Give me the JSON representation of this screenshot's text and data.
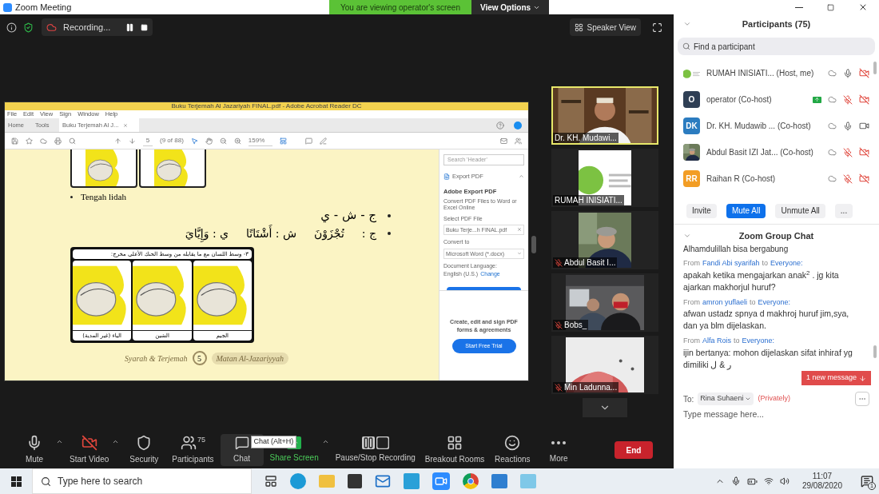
{
  "window": {
    "title": "Zoom Meeting"
  },
  "banner": {
    "text": "You are viewing operator's screen",
    "options": "View Options"
  },
  "top_bar": {
    "recording": "Recording...",
    "view_button": "Speaker View"
  },
  "shared_screen": {
    "app_title": "Buku Terjemah Al Jazariyah FINAL.pdf - Adobe Acrobat Reader DC",
    "menu": [
      "File",
      "Edit",
      "View",
      "Sign",
      "Window",
      "Help"
    ],
    "tabs": [
      {
        "label": "Home",
        "selected": false
      },
      {
        "label": "Tools",
        "selected": false
      },
      {
        "label": "Buku Terjemah Al J...",
        "selected": true
      }
    ],
    "page_field": "5",
    "page_count": "(9 of 88)",
    "zoom": "159%",
    "document": {
      "bullet": "Tengah lidah",
      "arabic_line": "ج - ش - ي",
      "examples": [
        "ج  :",
        "تُجْزَوْنَ",
        "ش : أَشْتَاتًا",
        "ي : وَإِيَّايَ"
      ],
      "figure_caption": "٣- وسط اللسان مع ما يقابله من وسط الحنك الأعلى مخرج:",
      "figure_labels": [
        "الجيم",
        "الشين",
        "الياء (غير المدية)"
      ],
      "footer_left": "Syarah & Terjemah",
      "page_number": "5",
      "footer_right": "Matan Al-Jazariyyah"
    },
    "side_pane": {
      "search_placeholder": "Search 'Header'",
      "section": "Export PDF",
      "heading": "Adobe Export PDF",
      "description": "Convert PDF Files to Word or Excel Online",
      "select_label": "Select PDF File",
      "file": "Buku Terje...h FINAL.pdf",
      "convert_label": "Convert to",
      "convert_value": "Microsoft Word (*.docx)",
      "language_label": "Document Language:",
      "language_value": "English (U.S.)",
      "change_link": "Change",
      "promo": "Create, edit and sign PDF forms & agreements",
      "trial_button": "Start Free Trial"
    }
  },
  "video_tiles": [
    {
      "name": "Dr. KH. Mudawi...",
      "active": true,
      "mic_muted": false
    },
    {
      "name": "RUMAH INISIATI...",
      "active": false,
      "mic_muted": false
    },
    {
      "name": "Abdul Basit I...",
      "active": false,
      "mic_muted": true
    },
    {
      "name": "Bobs_",
      "active": false,
      "mic_muted": true
    },
    {
      "name": "Min Ladunna...",
      "active": false,
      "mic_muted": true
    }
  ],
  "participants": {
    "title": "Participants (75)",
    "search_placeholder": "Find a participant",
    "rows": [
      {
        "kind": "picture",
        "label": "RUMAH INISIATI...  (Host, me)",
        "sharing": false,
        "mic_muted": false,
        "video_off": true
      },
      {
        "kind": "initials",
        "initials": "O",
        "color": "#2f3f55",
        "label": "operator (Co-host)",
        "sharing": true,
        "mic_muted": true,
        "video_off": true
      },
      {
        "kind": "initials",
        "initials": "DK",
        "color": "#2b7cc0",
        "label": "Dr. KH. Mudawib ... (Co-host)",
        "sharing": false,
        "mic_muted": false,
        "video_off": false
      },
      {
        "kind": "picture",
        "label": "Abdul Basit IZI Jat... (Co-host)",
        "sharing": false,
        "mic_muted": true,
        "video_off": true
      },
      {
        "kind": "initials",
        "initials": "RR",
        "color": "#f29d25",
        "label": "Raihan R (Co-host)",
        "sharing": false,
        "mic_muted": true,
        "video_off": true
      }
    ],
    "buttons": [
      {
        "label": "Invite",
        "primary": false
      },
      {
        "label": "Mute All",
        "primary": true
      },
      {
        "label": "Unmute All",
        "primary": false
      },
      {
        "label": "...",
        "primary": false
      }
    ]
  },
  "chat": {
    "title": "Zoom Group Chat",
    "partial_line": "Alhamdulillah bisa bergabung",
    "messages": [
      {
        "prefix": "From",
        "from": "Fandi Abi syarifah",
        "joiner": "to",
        "to": "Everyone:",
        "text": "apakah ketika mengajarkan anak$^{2}$ . jg kita ajarkan makhorjul huruf?"
      },
      {
        "prefix": "From",
        "from": "amron yuflaeli",
        "joiner": "to",
        "to": "Everyone:",
        "text": "afwan ustadz spnya d makhroj huruf jim,sya, dan ya blm dijelaskan."
      },
      {
        "prefix": "From",
        "from": "Alfa Rois",
        "joiner": "to",
        "to": "Everyone:",
        "text": "ijin bertanya: mohon dijelaskan sifat inhiraf yg dimiliki ر & ل"
      }
    ],
    "new_message": "1 new message",
    "to_label": "To:",
    "recipient": "Rina Suhaeni",
    "privacy": "(Privately)",
    "placeholder": "Type message here..."
  },
  "toolbar": {
    "items": [
      {
        "kind": "mic",
        "label": "Mute",
        "caret": true
      },
      {
        "kind": "video",
        "label": "Start Video",
        "caret": true,
        "off": true
      },
      {
        "kind": "security",
        "label": "Security",
        "caret": false
      },
      {
        "kind": "participants",
        "label": "Participants",
        "count": "75",
        "caret": false
      },
      {
        "kind": "chat",
        "label": "Chat",
        "caret": false,
        "tooltip": "Chat (Alt+H)"
      },
      {
        "kind": "share",
        "label": "Share Screen",
        "caret": true
      },
      {
        "kind": "record",
        "label": "Pause/Stop Recording",
        "caret": false
      },
      {
        "kind": "breakout",
        "label": "Breakout Rooms",
        "caret": false
      },
      {
        "kind": "reactions",
        "label": "Reactions",
        "caret": false
      },
      {
        "kind": "more",
        "label": "More",
        "caret": false
      }
    ],
    "end": "End"
  },
  "taskbar": {
    "search_placeholder": "Type here to search",
    "time": "11:07",
    "date": "29/08/2020",
    "notifications": "1"
  }
}
